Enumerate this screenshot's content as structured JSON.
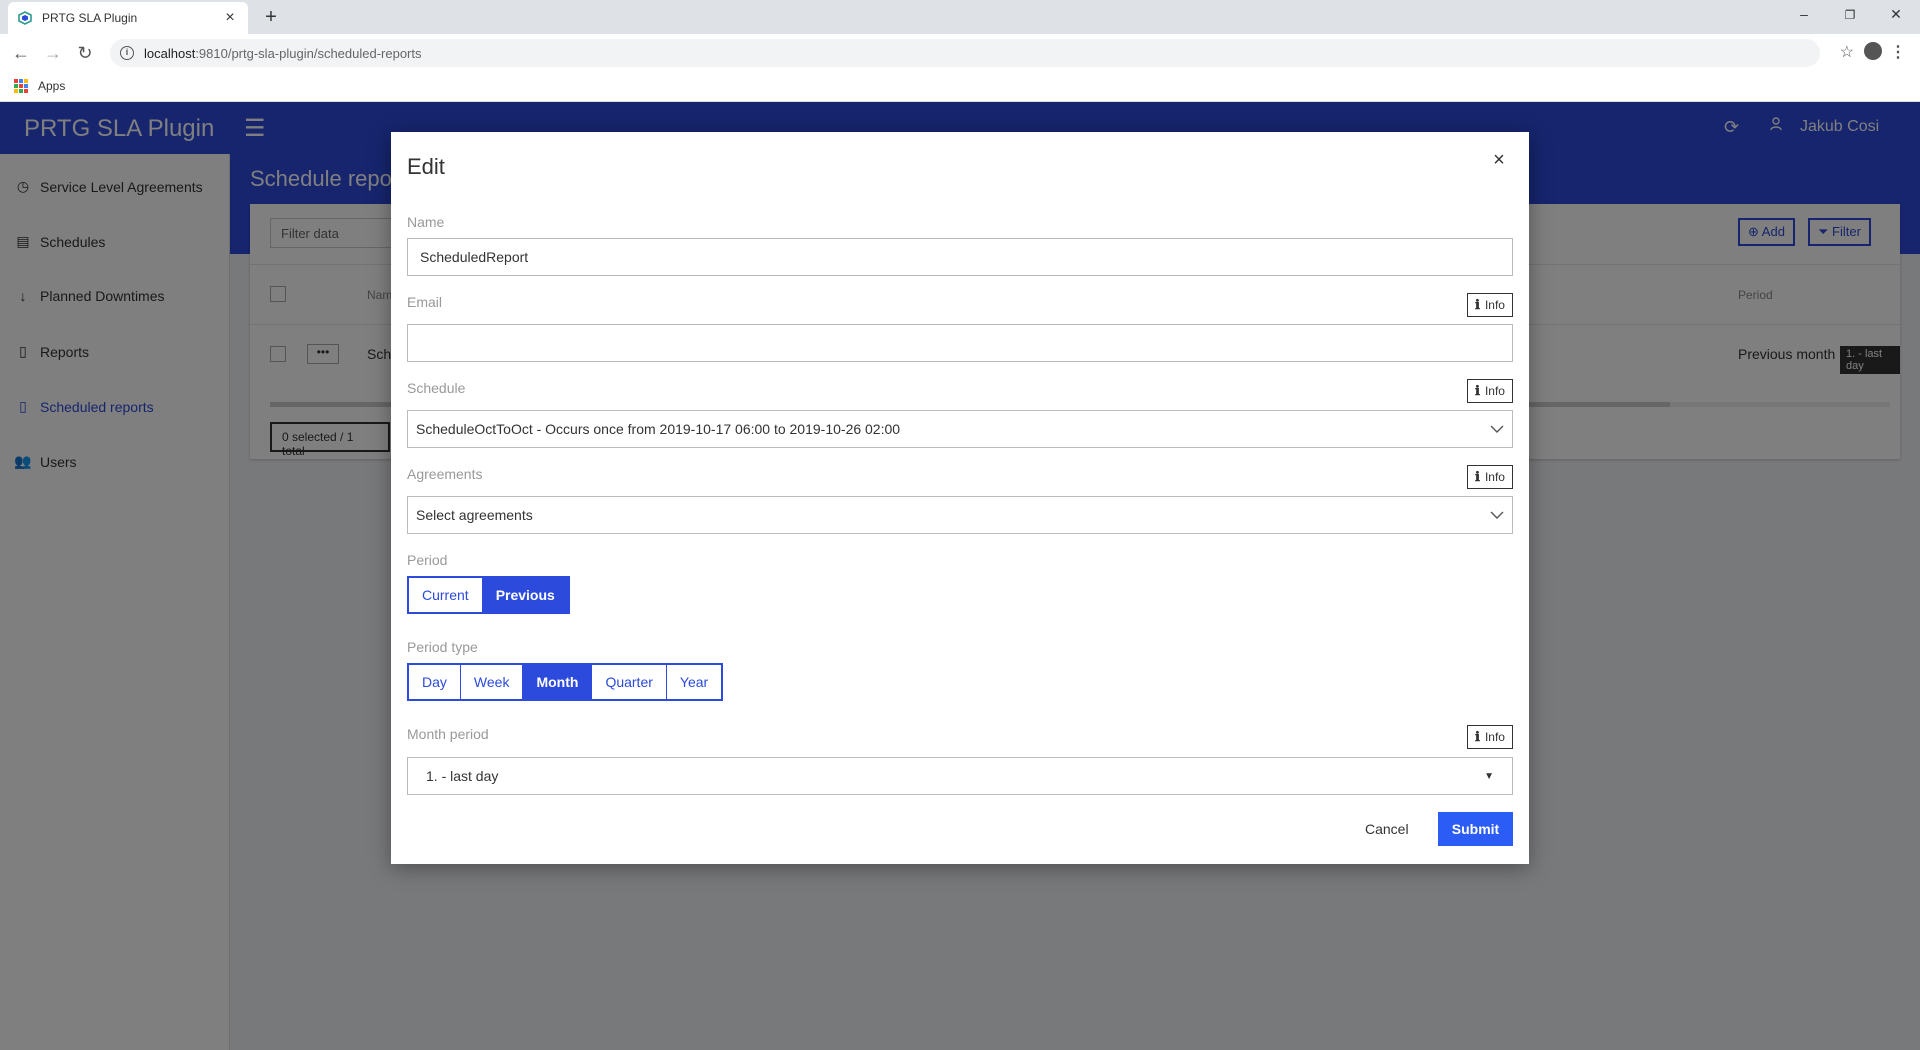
{
  "browser": {
    "tab_title": "PRTG SLA Plugin",
    "tab_close": "×",
    "new_tab": "+",
    "url_host": "localhost",
    "url_path": ":9810/prtg-sla-plugin/scheduled-reports",
    "bookmark_apps": "Apps",
    "win_minimize": "–",
    "win_restore": "❐",
    "win_close": "✕"
  },
  "app": {
    "brand": "PRTG SLA Plugin",
    "user_name": "Jakub Cosi",
    "page_title": "Schedule reports",
    "filter_placeholder": "Filter data",
    "add_label": "Add",
    "filter_label": "Filter",
    "table": {
      "col_name": "Name",
      "col_period": "Period",
      "row_name": "ScheduledReport",
      "row_period": "Previous month",
      "row_tag": "1. - last day"
    },
    "footer_count": "0 selected / 1 total"
  },
  "sidebar": {
    "items": [
      {
        "label": "Service Level Agreements"
      },
      {
        "label": "Schedules"
      },
      {
        "label": "Planned Downtimes"
      },
      {
        "label": "Reports"
      },
      {
        "label": "Scheduled reports"
      },
      {
        "label": "Users"
      }
    ]
  },
  "modal": {
    "title": "Edit",
    "close": "×",
    "name_label": "Name",
    "name_value": "ScheduledReport",
    "email_label": "Email",
    "email_value": "",
    "info_label": "Info",
    "schedule_label": "Schedule",
    "schedule_value": "ScheduleOctToOct - Occurs once from 2019-10-17 06:00 to 2019-10-26 02:00",
    "agreements_label": "Agreements",
    "agreements_value": "Select agreements",
    "period_label": "Period",
    "period_options": [
      "Current",
      "Previous"
    ],
    "period_selected": "Previous",
    "period_type_label": "Period type",
    "period_type_options": [
      "Day",
      "Week",
      "Month",
      "Quarter",
      "Year"
    ],
    "period_type_selected": "Month",
    "month_period_label": "Month period",
    "month_period_value": "1. - last day",
    "cancel_label": "Cancel",
    "submit_label": "Submit"
  },
  "colors": {
    "brand_blue": "#2c4adb",
    "submit_blue": "#2c5cf6"
  }
}
